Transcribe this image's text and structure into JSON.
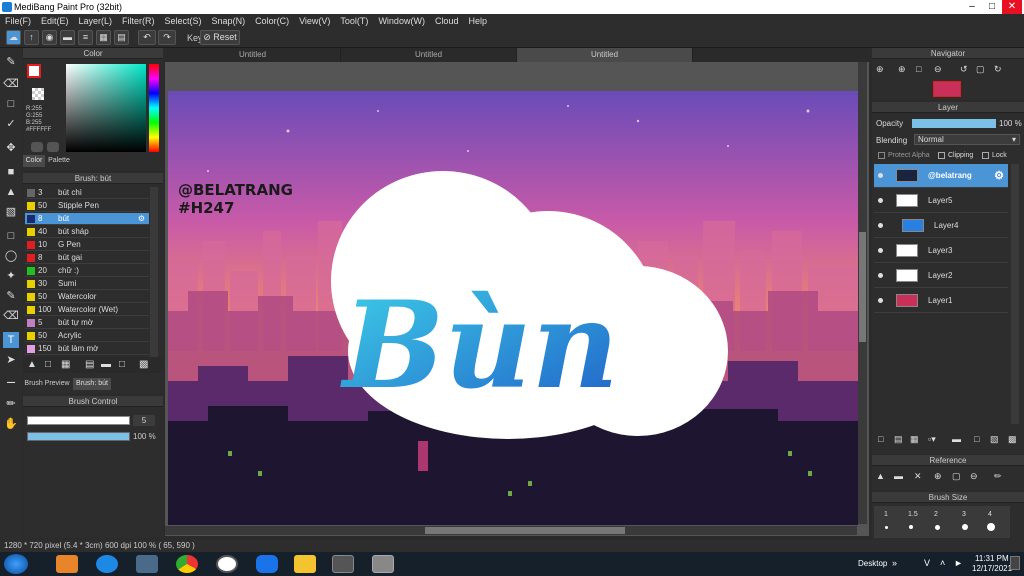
{
  "app": {
    "title": "MediBang Paint Pro (32bit)"
  },
  "menu": [
    "File(F)",
    "Edit(E)",
    "Layer(L)",
    "Filter(R)",
    "Select(S)",
    "Snap(N)",
    "Color(C)",
    "View(V)",
    "Tool(T)",
    "Window(W)",
    "Cloud",
    "Help"
  ],
  "toolbar": {
    "key_label": "Key",
    "reset_label": "Reset"
  },
  "tabs": [
    "Untitled",
    "Untitled",
    "Untitled"
  ],
  "color": {
    "title": "Color",
    "r": "R:255",
    "g": "G:255",
    "b": "B:255",
    "hex": "#FFFFFF",
    "tab_color": "Color",
    "tab_palette": "Palette"
  },
  "brush": {
    "title": "Brush: bút",
    "items": [
      {
        "size": "3",
        "name": "bút chì",
        "color": "#666666"
      },
      {
        "size": "50",
        "name": "Stipple Pen",
        "color": "#e8d000"
      },
      {
        "size": "8",
        "name": "bút",
        "color": "#1a2a6a"
      },
      {
        "size": "40",
        "name": "bút sháp",
        "color": "#e8d000"
      },
      {
        "size": "10",
        "name": "G Pen",
        "color": "#e02020"
      },
      {
        "size": "8",
        "name": "bút gai",
        "color": "#e02020"
      },
      {
        "size": "20",
        "name": "chữ :)",
        "color": "#20c020"
      },
      {
        "size": "30",
        "name": "Sumi",
        "color": "#e8d000"
      },
      {
        "size": "50",
        "name": "Watercolor",
        "color": "#e8d000"
      },
      {
        "size": "100",
        "name": "Watercolor (Wet)",
        "color": "#e8d000"
      },
      {
        "size": "5",
        "name": "bút tự mờ",
        "color": "#c080c0"
      },
      {
        "size": "50",
        "name": "Acrylic",
        "color": "#e8d000"
      },
      {
        "size": "150",
        "name": "bút làm mờ",
        "color": "#e0a0e0"
      }
    ],
    "tab_preview": "Brush Preview",
    "tab_brush": "Brush: bút"
  },
  "brush_control": {
    "title": "Brush Control",
    "size": "5",
    "opacity": "100 %",
    "opacity_fill": 1.0
  },
  "canvas": {
    "watermark_1": "@BELATRANG",
    "watermark_2": "#H247",
    "lettering": "Bùn"
  },
  "status": {
    "text": "1280 * 720 pixel   (5.4 * 3cm)   600 dpi   100 %   ( 65, 590 )"
  },
  "navigator": {
    "title": "Navigator"
  },
  "layer": {
    "title": "Layer",
    "opacity_label": "Opacity",
    "opacity_value": "100 %",
    "opacity_fill": 1.0,
    "blending_label": "Blending",
    "blending_value": "Normal",
    "protect_alpha": "Protect Alpha",
    "clipping": "Clipping",
    "lock": "Lock",
    "items": [
      {
        "name": "@belatrang",
        "selected": true,
        "indent": false
      },
      {
        "name": "Layer5",
        "selected": false,
        "indent": false
      },
      {
        "name": "Layer4",
        "selected": false,
        "indent": true
      },
      {
        "name": "Layer3",
        "selected": false,
        "indent": false
      },
      {
        "name": "Layer2",
        "selected": false,
        "indent": false
      },
      {
        "name": "Layer1",
        "selected": false,
        "indent": false
      }
    ]
  },
  "reference": {
    "title": "Reference"
  },
  "brush_size": {
    "title": "Brush Size",
    "values": [
      "1",
      "1.5",
      "2",
      "3",
      "4"
    ]
  },
  "taskbar": {
    "desktop_label": "Desktop",
    "time": "11:31 PM",
    "date": "12/17/2021"
  },
  "icons": [
    "search-icon",
    "gear-icon",
    "undo-icon",
    "redo-icon",
    "pen-icon",
    "eraser-icon",
    "select-icon",
    "move-icon",
    "fill-icon",
    "text-icon",
    "hand-icon",
    "eye-icon",
    "zoom-in-icon",
    "zoom-out-icon",
    "windows-start-icon",
    "edge-icon",
    "chrome-icon",
    "folder-icon",
    "zalo-icon"
  ]
}
